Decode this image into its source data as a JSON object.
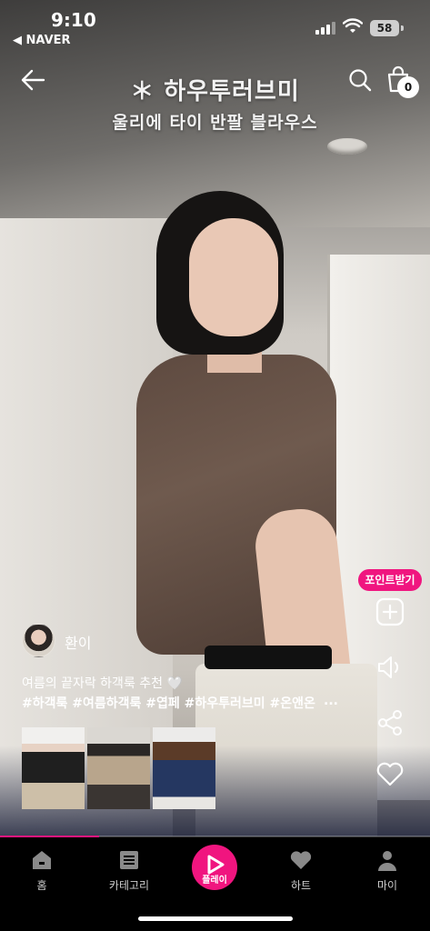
{
  "status_bar": {
    "time": "9:10",
    "back_app": "◀ NAVER",
    "battery": "58"
  },
  "video": {
    "title_line1": "＊ 하우투러브미",
    "title_line2": "울리에 타이 반팔 블라우스",
    "progress_fraction": 0.23
  },
  "header": {
    "cart_count": "0"
  },
  "actions": {
    "point_badge": "포인트받기"
  },
  "creator": {
    "name": "환이"
  },
  "caption": {
    "text": "여름의 끝자락 하객룩 추천 🤍",
    "hashtags": "#하객룩 #여름하객룩 #엽페 #하우투러브미 #온앤온",
    "more": "..."
  },
  "products": [
    {
      "icon": "product-thumbnail-1"
    },
    {
      "icon": "product-thumbnail-2"
    },
    {
      "icon": "product-thumbnail-3"
    }
  ],
  "bottom_nav": {
    "home": "홈",
    "category": "카테고리",
    "play": "플레이",
    "like": "하트",
    "my": "마이"
  },
  "colors": {
    "accent": "#f0157f",
    "nav_bg": "#000000"
  }
}
